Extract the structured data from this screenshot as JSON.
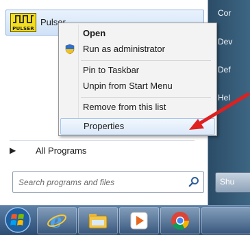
{
  "program": {
    "name": "Pulser",
    "logo_text": "PULSER"
  },
  "context_menu": {
    "items": [
      {
        "label": "Open"
      },
      {
        "label": "Run as administrator"
      },
      {
        "label": "Pin to Taskbar"
      },
      {
        "label": "Unpin from Start Menu"
      },
      {
        "label": "Remove from this list"
      },
      {
        "label": "Properties"
      }
    ]
  },
  "start_menu": {
    "all_programs": "All Programs",
    "search_placeholder": "Search programs and files"
  },
  "right_panel": {
    "items": [
      "Cor",
      "Dev",
      "Def",
      "Hel"
    ],
    "shutdown": "Shu"
  },
  "colors": {
    "annotation_arrow": "#e01f1f",
    "taskbar": "#3a5d86",
    "logo_background": "#f3de1f"
  },
  "taskbar_icons": [
    "start-orb-icon",
    "internet-explorer-icon",
    "file-explorer-icon",
    "media-player-icon",
    "chrome-icon"
  ]
}
